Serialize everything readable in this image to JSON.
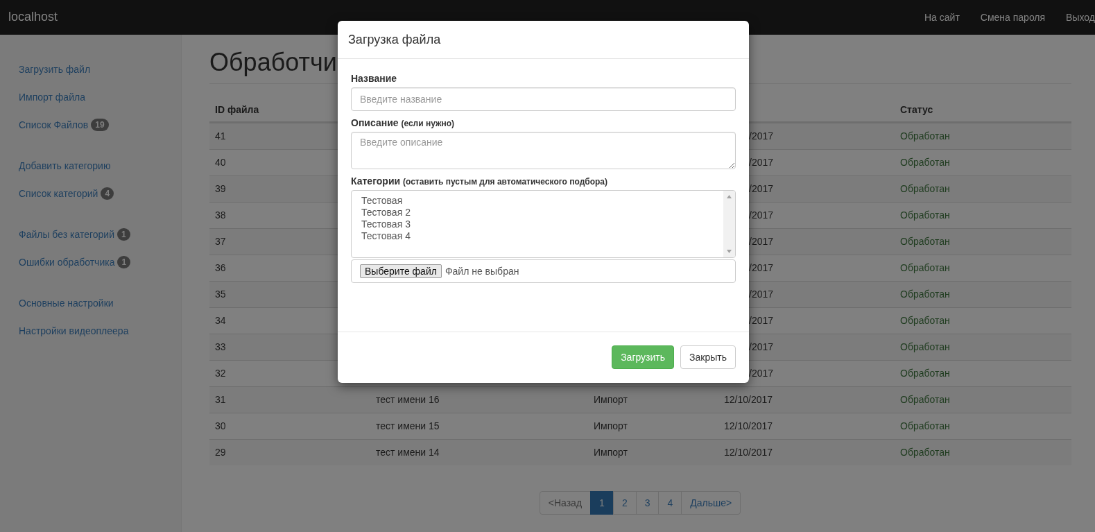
{
  "navbar": {
    "brand": "localhost",
    "links": [
      "На сайт",
      "Смена пароля",
      "Выход"
    ]
  },
  "sidebar": {
    "groups": [
      {
        "items": [
          {
            "label": "Загрузить файл"
          },
          {
            "label": "Импорт файла"
          },
          {
            "label": "Список Файлов",
            "badge": "19"
          }
        ]
      },
      {
        "items": [
          {
            "label": "Добавить категорию"
          },
          {
            "label": "Список категорий",
            "badge": "4"
          }
        ]
      },
      {
        "items": [
          {
            "label": "Файлы без категорий",
            "badge": "1"
          },
          {
            "label": "Ошибки обработчика",
            "badge": "1"
          }
        ]
      },
      {
        "items": [
          {
            "label": "Основные настройки"
          },
          {
            "label": "Настройки видеоплеера"
          }
        ]
      }
    ]
  },
  "page": {
    "title": "Обработчи"
  },
  "table": {
    "header": {
      "id": "ID файла",
      "status": "Статус"
    },
    "rows": [
      {
        "id": "41",
        "date": "/2017",
        "status": "Обработан"
      },
      {
        "id": "40",
        "date": "/2017",
        "status": "Обработан"
      },
      {
        "id": "39",
        "date": "/2017",
        "status": "Обработан"
      },
      {
        "id": "38",
        "date": "/2017",
        "status": "Обработан"
      },
      {
        "id": "37",
        "date": "/2017",
        "status": "Обработан"
      },
      {
        "id": "36",
        "date": "/2017",
        "status": "Обработан"
      },
      {
        "id": "35",
        "date": "/2017",
        "status": "Обработан"
      },
      {
        "id": "34",
        "date": "/2017",
        "status": "Обработан"
      },
      {
        "id": "33",
        "date": "/2017",
        "status": "Обработан"
      },
      {
        "id": "32",
        "date": "/2017",
        "status": "Обработан"
      },
      {
        "id": "31",
        "name": "тест имени 16",
        "type": "Импорт",
        "date": "12/10/2017",
        "status": "Обработан"
      },
      {
        "id": "30",
        "name": "тест имени 15",
        "type": "Импорт",
        "date": "12/10/2017",
        "status": "Обработан"
      },
      {
        "id": "29",
        "name": "тест имени 14",
        "type": "Импорт",
        "date": "12/10/2017",
        "status": "Обработан"
      }
    ]
  },
  "pagination": [
    {
      "label": "<Назад",
      "kind": "prev",
      "disabled": true,
      "selected": false
    },
    {
      "label": "1",
      "kind": "page",
      "disabled": false,
      "selected": true
    },
    {
      "label": "2",
      "kind": "page",
      "disabled": false,
      "selected": false
    },
    {
      "label": "3",
      "kind": "page",
      "disabled": false,
      "selected": false
    },
    {
      "label": "4",
      "kind": "page",
      "disabled": false,
      "selected": false
    },
    {
      "label": "Дальше>",
      "kind": "next",
      "disabled": false,
      "selected": false
    }
  ],
  "modal": {
    "title": "Загрузка файла",
    "name_field": {
      "label": "Название",
      "placeholder": "Введите название"
    },
    "description_field": {
      "label": "Описание",
      "note": "(если нужно)",
      "placeholder": "Введите описание"
    },
    "categories_field": {
      "label": "Категории",
      "note": "(оставить пустым для автоматического подбора)",
      "options": [
        "Тестовая",
        "Тестовая 2",
        "Тестовая 3",
        "Тестовая 4"
      ]
    },
    "file_field": {
      "button": "Выберите файл",
      "status": "Файл не выбран"
    },
    "buttons": [
      {
        "label": "Загрузить",
        "kind": "primary"
      },
      {
        "label": "Закрыть",
        "kind": "default"
      }
    ]
  }
}
